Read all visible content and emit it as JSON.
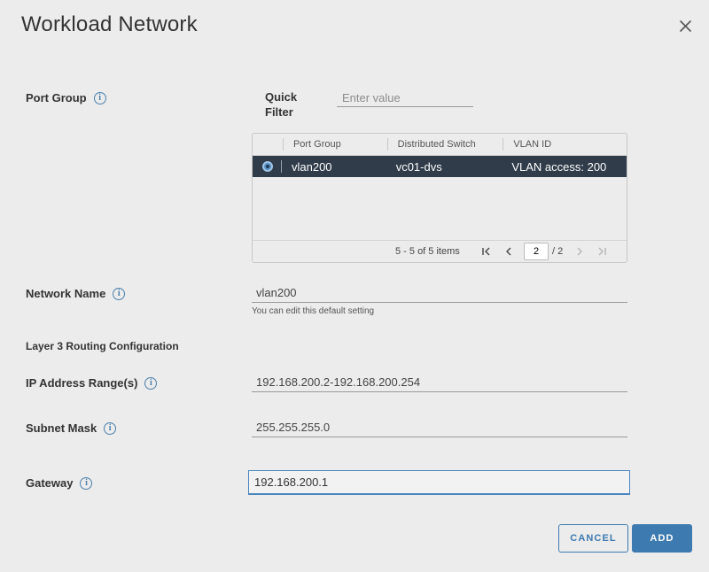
{
  "dialog": {
    "title": "Workload Network"
  },
  "port_group": {
    "label": "Port Group",
    "quick_filter_label": "Quick Filter",
    "quick_filter_placeholder": "Enter value",
    "quick_filter_value": "",
    "columns": [
      "Port Group",
      "Distributed Switch",
      "VLAN ID"
    ],
    "rows": [
      {
        "selected": true,
        "port_group": "vlan200",
        "distributed_switch": "vc01-dvs",
        "vlan_id": "VLAN access: 200"
      }
    ],
    "footer": {
      "items_text": "5 - 5 of 5 items",
      "current_page": "2",
      "total_pages": "/ 2"
    }
  },
  "network_name": {
    "label": "Network Name",
    "value": "vlan200",
    "helper": "You can edit this default setting"
  },
  "layer3": {
    "heading": "Layer 3 Routing Configuration"
  },
  "ip_range": {
    "label": "IP Address Range(s)",
    "value": "192.168.200.2-192.168.200.254"
  },
  "subnet_mask": {
    "label": "Subnet Mask",
    "value": "255.255.255.0"
  },
  "gateway": {
    "label": "Gateway",
    "value": "192.168.200.1"
  },
  "buttons": {
    "cancel": "CANCEL",
    "add": "ADD"
  },
  "colors": {
    "accent": "#3d7ab0",
    "selected_row": "#303c4a",
    "background": "#ececec"
  },
  "icons": {
    "info": "info-circle-icon",
    "close": "close-icon",
    "first_page": "first-page-icon",
    "prev_page": "chevron-left-icon",
    "next_page": "chevron-right-icon",
    "last_page": "last-page-icon",
    "radio": "radio-selected-icon"
  }
}
